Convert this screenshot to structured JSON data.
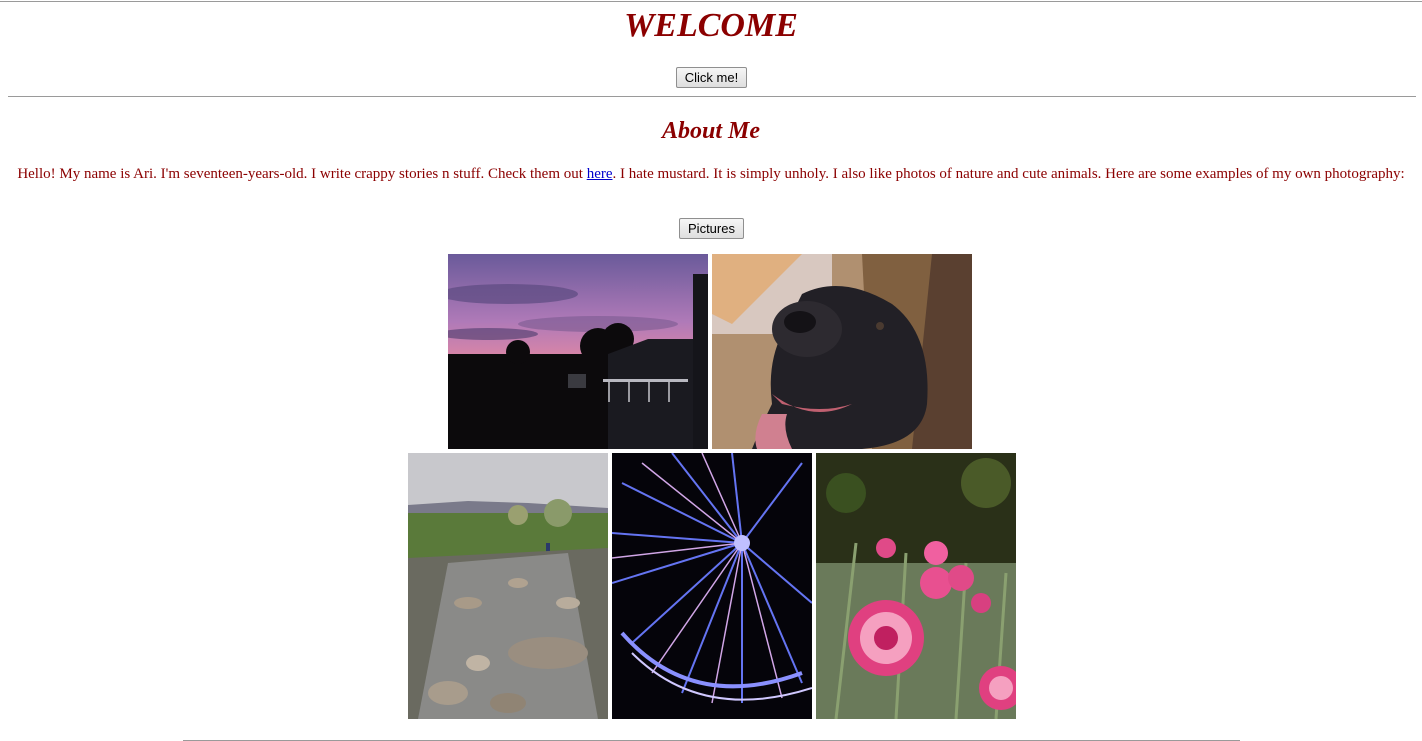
{
  "header": {
    "title": "WELCOME",
    "button_label": "Click me!"
  },
  "about": {
    "heading": "About Me",
    "bio_before_link": "Hello! My name is Ari. I'm seventeen-years-old. I write crappy stories n stuff. Check them out ",
    "link_text": "here",
    "bio_after_link": ". I hate mustard. It is simply unholy. I also like photos of nature and cute animals. Here are some examples of my own photography:",
    "pictures_button_label": "Pictures"
  },
  "gallery": {
    "photos": [
      {
        "subject": "sunset-photo"
      },
      {
        "subject": "dog-photo"
      },
      {
        "subject": "stream-photo"
      },
      {
        "subject": "ferris-wheel-photo"
      },
      {
        "subject": "flowers-photo"
      }
    ]
  },
  "colors": {
    "text": "#8b0000",
    "link": "#0000cc",
    "rule": "#9a9a9a"
  }
}
